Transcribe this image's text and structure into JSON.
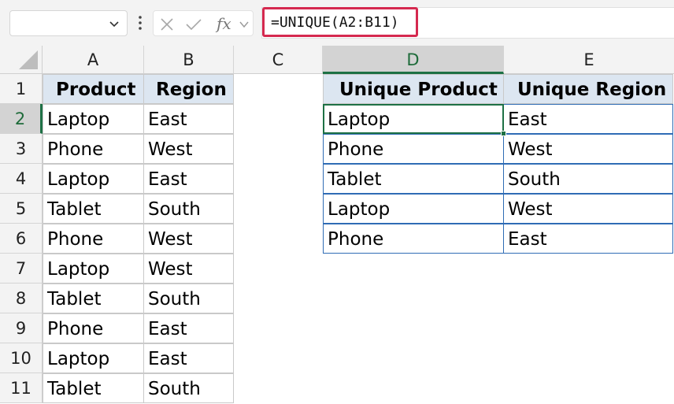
{
  "formula_bar": {
    "name_box": "",
    "formula": "=UNIQUE(A2:B11)",
    "fx_label": "fx"
  },
  "columns": [
    "A",
    "B",
    "C",
    "D",
    "E"
  ],
  "rows": [
    "1",
    "2",
    "3",
    "4",
    "5",
    "6",
    "7",
    "8",
    "9",
    "10",
    "11"
  ],
  "source_table": {
    "headers": [
      "Product",
      "Region"
    ],
    "rows": [
      [
        "Laptop",
        "East"
      ],
      [
        "Phone",
        "West"
      ],
      [
        "Laptop",
        "East"
      ],
      [
        "Tablet",
        "South"
      ],
      [
        "Phone",
        "West"
      ],
      [
        "Laptop",
        "West"
      ],
      [
        "Tablet",
        "South"
      ],
      [
        "Phone",
        "East"
      ],
      [
        "Laptop",
        "East"
      ],
      [
        "Tablet",
        "South"
      ]
    ]
  },
  "unique_table": {
    "headers": [
      "Unique Product",
      "Unique Region"
    ],
    "rows": [
      [
        "Laptop",
        "East"
      ],
      [
        "Phone",
        "West"
      ],
      [
        "Tablet",
        "South"
      ],
      [
        "Laptop",
        "West"
      ],
      [
        "Phone",
        "East"
      ]
    ]
  },
  "selection": {
    "active_cell": "D2",
    "column": "D",
    "row": "2"
  },
  "colors": {
    "accent": "#1e7145",
    "formula_highlight": "#d5294f",
    "header_fill": "#dce6f1"
  }
}
